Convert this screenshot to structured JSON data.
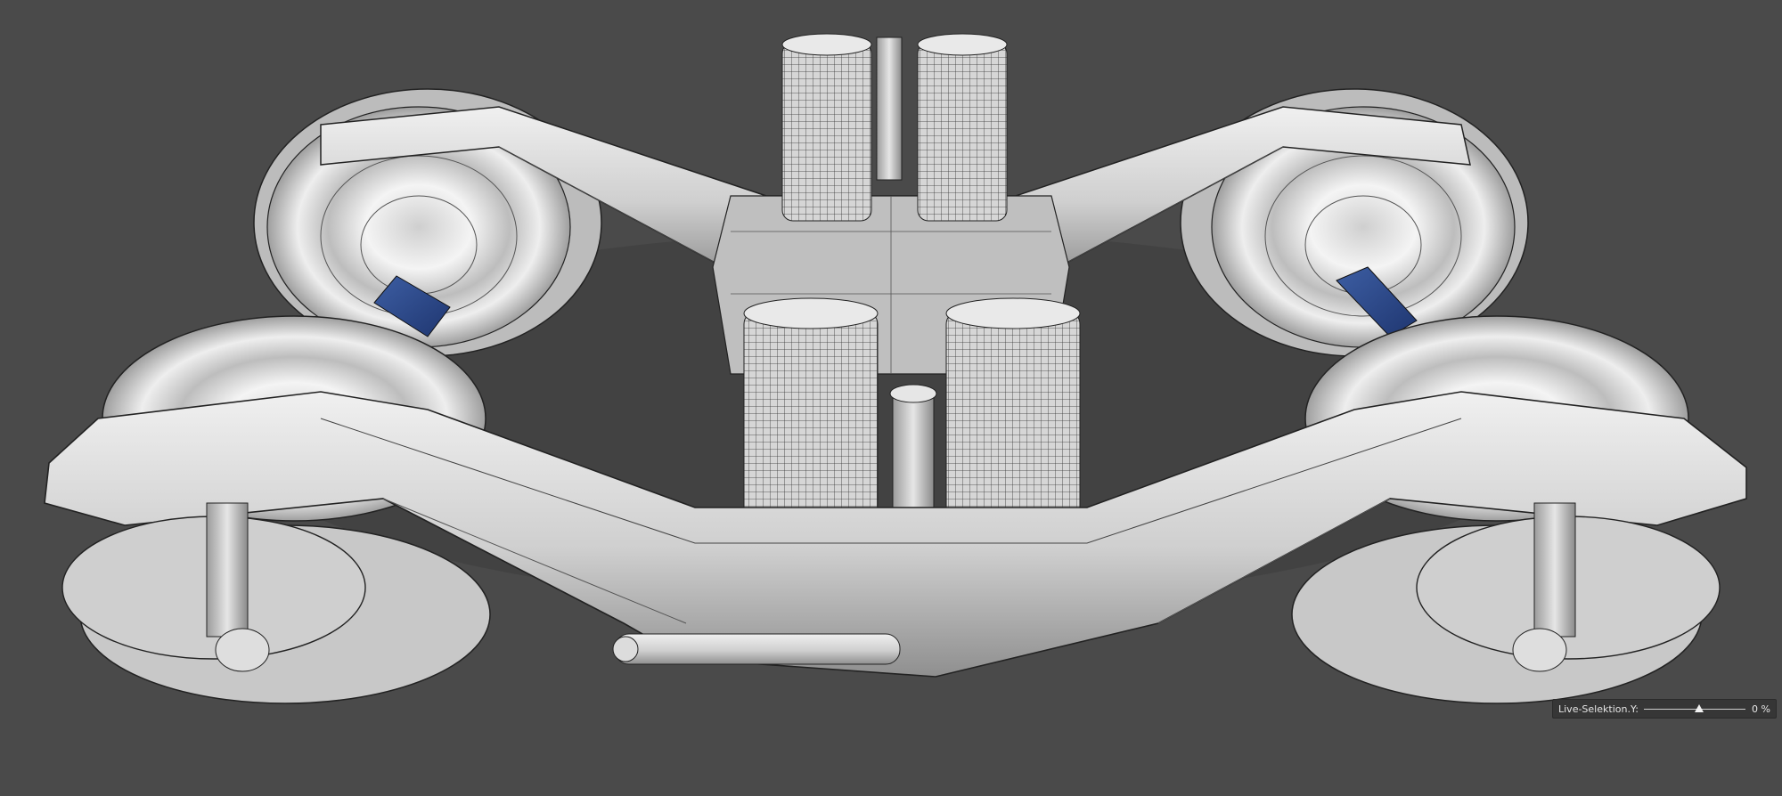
{
  "viewport": {
    "background_color": "#4a4a4a",
    "model_colors": {
      "body": "#cfcfcf",
      "wireframe": "#222222",
      "axle": "#2c4a8c"
    }
  },
  "hud": {
    "label": "Live-Selektion.Y:",
    "value_text": "0 %",
    "slider_fraction": 0.54
  }
}
